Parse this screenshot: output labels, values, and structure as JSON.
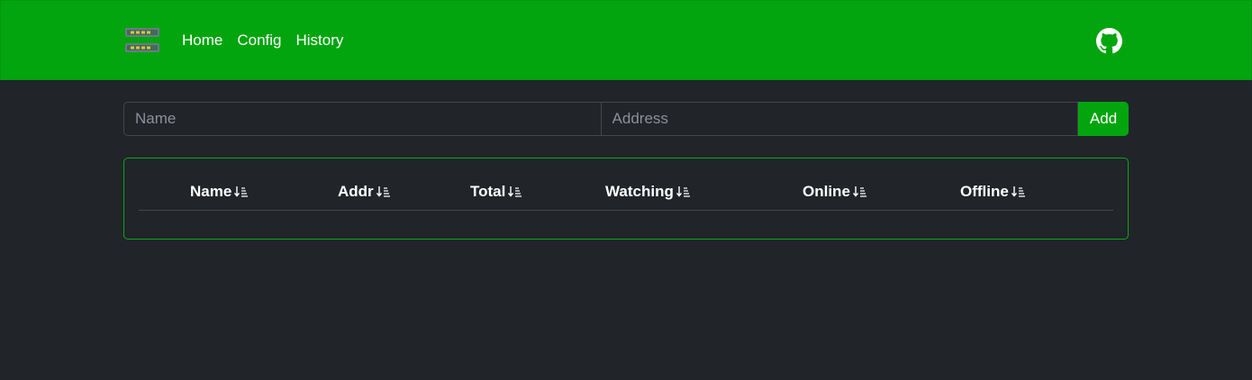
{
  "nav": {
    "links": [
      "Home",
      "Config",
      "History"
    ],
    "brand_icon": "server-rack-icon",
    "github_icon": "github-icon",
    "bg_color": "#02a50d"
  },
  "form": {
    "name_placeholder": "Name",
    "address_placeholder": "Address",
    "add_label": "Add"
  },
  "table": {
    "columns": [
      "Name",
      "Addr",
      "Total",
      "Watching",
      "Online",
      "Offline"
    ],
    "sort_icon": "sort-descending-icon",
    "rows": []
  }
}
